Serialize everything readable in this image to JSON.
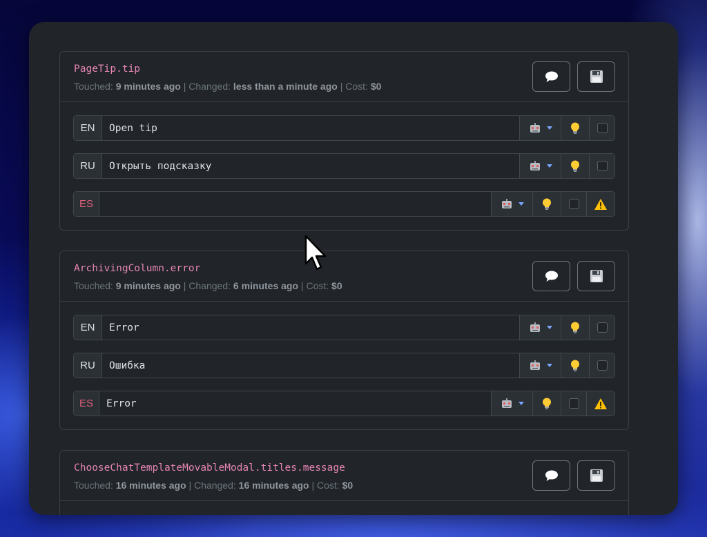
{
  "entries": [
    {
      "key": "PageTip.tip",
      "touched_label": "Touched:",
      "touched": "9 minutes ago",
      "changed_label": "Changed:",
      "changed": "less than a minute ago",
      "cost_label": "Cost:",
      "cost": "$0",
      "translations": [
        {
          "lang": "EN",
          "value": "Open tip",
          "warning": false
        },
        {
          "lang": "RU",
          "value": "Открыть подсказку",
          "warning": false
        },
        {
          "lang": "ES",
          "value": "",
          "warning": true
        }
      ]
    },
    {
      "key": "ArchivingColumn.error",
      "touched_label": "Touched:",
      "touched": "9 minutes ago",
      "changed_label": "Changed:",
      "changed": "6 minutes ago",
      "cost_label": "Cost:",
      "cost": "$0",
      "translations": [
        {
          "lang": "EN",
          "value": "Error",
          "warning": false
        },
        {
          "lang": "RU",
          "value": "Ошибка",
          "warning": false
        },
        {
          "lang": "ES",
          "value": "Error",
          "warning": true
        }
      ]
    },
    {
      "key": "ChooseChatTemplateMovableModal.titles.message",
      "touched_label": "Touched:",
      "touched": "16 minutes ago",
      "changed_label": "Changed:",
      "changed": "16 minutes ago",
      "cost_label": "Cost:",
      "cost": "$0",
      "translations": []
    }
  ],
  "icons": {
    "comment": "comment-icon",
    "save": "save-icon",
    "robot": "robot-icon",
    "bulb": "lightbulb-icon",
    "warning": "warning-icon"
  },
  "colors": {
    "key": "#e685b5",
    "warning_lang": "#e0607a",
    "caret": "#7aa6ff",
    "card_bg": "#212529"
  }
}
